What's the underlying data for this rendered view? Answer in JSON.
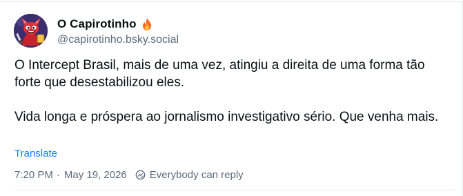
{
  "author": {
    "display_name": "O Capirotinho",
    "handle": "@capirotinho.bsky.social",
    "badge_icon": "flame-icon",
    "avatar_icon": "devil-cat-avatar"
  },
  "post": {
    "paragraphs": [
      "O Intercept Brasil, mais de uma vez, atingiu a direita de uma forma tão forte que desestabilizou eles.",
      "Vida longa e próspera ao jornalismo investigativo sério. Que venha mais."
    ],
    "translate_label": "Translate"
  },
  "meta": {
    "time": "7:20 PM",
    "separator": "·",
    "date": "May 19, 2026",
    "reply_setting_icon": "globe-reply-icon",
    "reply_setting_label": "Everybody can reply"
  },
  "colors": {
    "link": "#1083fe",
    "secondary_text": "#5b6b7b",
    "primary_text": "#0b0f14",
    "divider": "#e7ebef"
  }
}
